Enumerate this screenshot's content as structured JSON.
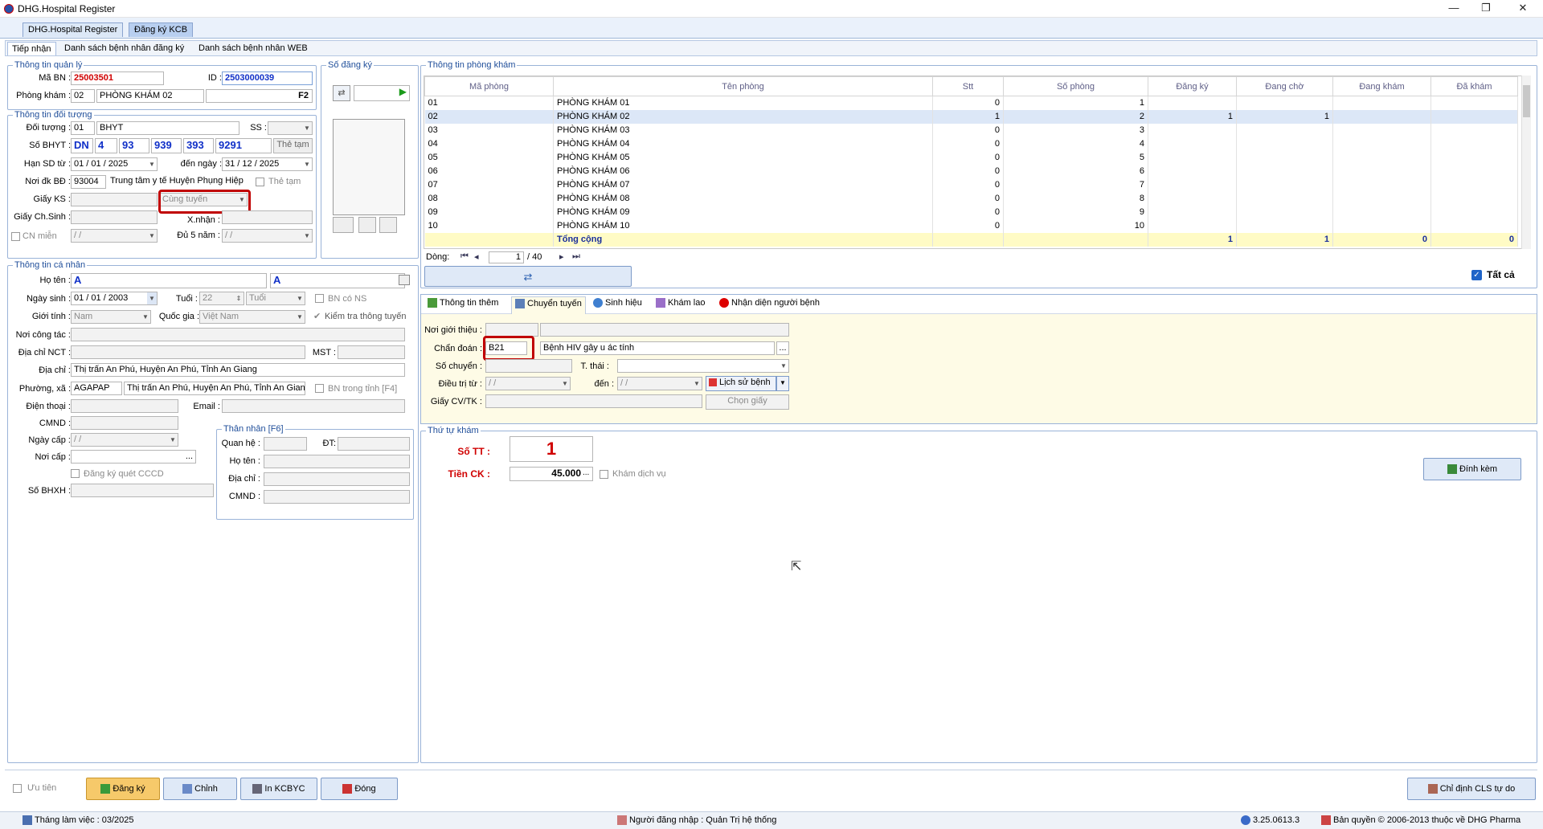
{
  "window": {
    "title": "DHG.Hospital Register",
    "minimize": "—",
    "maximize": "❐",
    "close": "✕"
  },
  "doc_tabs": [
    "DHG.Hospital Register",
    "Đăng ký KCB"
  ],
  "sub_tabs": [
    "Tiếp nhận",
    "Danh sách bệnh nhân đăng ký",
    "Danh sách bệnh nhân WEB"
  ],
  "quanly": {
    "title": "Thông tin quản lý",
    "ma_bn_label": "Mã BN :",
    "ma_bn": "25003501",
    "id_label": "ID :",
    "id": "2503000039",
    "phong_kham_label": "Phòng khám :",
    "phong_code": "02",
    "phong_name": "PHÒNG KHÁM 02",
    "f2": "F2"
  },
  "so_dangky": {
    "title": "Số đăng ký"
  },
  "doituong": {
    "title": "Thông tin đối tượng",
    "doi_tuong_label": "Đối tượng :",
    "doi_tuong_code": "01",
    "doi_tuong_name": "BHYT",
    "ss_label": "SS :",
    "so_bhyt_label": "Số BHYT :",
    "bhyt": [
      "DN",
      "4",
      "93",
      "939",
      "393",
      "9291"
    ],
    "the_tam_btn": "Thẻ tạm",
    "han_label": "Hạn SD từ :",
    "han_tu": "01 / 01 / 2025",
    "den_ngay_label": "đến ngày :",
    "han_den": "31 / 12 / 2025",
    "noi_dk_label": "Nơi đk BĐ :",
    "noi_dk_code": "93004",
    "noi_dk_name": "Trung tâm y tế Huyện Phụng Hiệp",
    "the_tam_chk": "Thẻ tạm",
    "giay_ks_label": "Giấy KS :",
    "tuyen": "Cùng tuyến",
    "giay_chsinh_label": "Giấy Ch.Sinh :",
    "xnhan_label": "X.nhận :",
    "cn_mien_label": "CN miễn",
    "date_blank": "/ /",
    "du5nam_label": "Đủ 5 năm :"
  },
  "canhan": {
    "title": "Thông tin cá nhân",
    "ho_ten_label": "Họ tên :",
    "ho_ten": "A",
    "ho_ten2": "A",
    "ngay_sinh_label": "Ngày sinh :",
    "ngay_sinh": "01 / 01 / 2003",
    "tuoi_label": "Tuổi :",
    "tuoi": "22",
    "tuoi_unit": "Tuổi",
    "bn_co_ns": "BN có NS",
    "gioi_tinh_label": "Giới tính :",
    "gioi_tinh": "Nam",
    "quoc_gia_label": "Quốc gia :",
    "quoc_gia": "Việt Nam",
    "kiem_tra": "Kiểm tra thông tuyến",
    "noi_cong_tac_label": "Nơi công tác :",
    "dia_chi_nct_label": "Địa chỉ NCT :",
    "mst_label": "MST :",
    "dia_chi_label": "Địa chỉ :",
    "dia_chi": "Thị trấn An Phú, Huyện An Phú, Tỉnh An Giang",
    "phuong_xa_label": "Phường, xã :",
    "phuong_code": "AGAPAP",
    "phuong_name": "Thị trấn An Phú, Huyện An Phú, Tỉnh An Giang",
    "bn_trong_tinh": "BN trong tỉnh [F4]",
    "dien_thoai_label": "Điện thoại :",
    "email_label": "Email :",
    "cmnd_label": "CMND :",
    "ngay_cap_label": "Ngày cấp :",
    "noi_cap_label": "Nơi cấp :",
    "dk_cccd": "Đăng ký quét CCCD",
    "so_bhxh_label": "Số BHXH :"
  },
  "thannhan": {
    "title": "Thân nhân [F6]",
    "quan_he_label": "Quan hệ :",
    "dt_label": "ĐT:",
    "ho_ten_label": "Họ tên :",
    "dia_chi_label": "Địa chỉ :",
    "cmnd_label": "CMND :"
  },
  "phongkham": {
    "title": "Thông tin phòng khám",
    "headers": [
      "Mã phòng",
      "Tên phòng",
      "Stt",
      "Số phòng",
      "Đăng ký",
      "Đang chờ",
      "Đang khám",
      "Đã khám"
    ],
    "rows": [
      [
        "01",
        "PHÒNG KHÁM 01",
        "0",
        "1",
        "",
        "",
        "",
        ""
      ],
      [
        "02",
        "PHÒNG KHÁM 02",
        "1",
        "2",
        "1",
        "1",
        "",
        ""
      ],
      [
        "03",
        "PHÒNG KHÁM 03",
        "0",
        "3",
        "",
        "",
        "",
        ""
      ],
      [
        "04",
        "PHÒNG KHÁM 04",
        "0",
        "4",
        "",
        "",
        "",
        ""
      ],
      [
        "05",
        "PHÒNG KHÁM 05",
        "0",
        "5",
        "",
        "",
        "",
        ""
      ],
      [
        "06",
        "PHÒNG KHÁM 06",
        "0",
        "6",
        "",
        "",
        "",
        ""
      ],
      [
        "07",
        "PHÒNG KHÁM 07",
        "0",
        "7",
        "",
        "",
        "",
        ""
      ],
      [
        "08",
        "PHÒNG KHÁM 08",
        "0",
        "8",
        "",
        "",
        "",
        ""
      ],
      [
        "09",
        "PHÒNG KHÁM 09",
        "0",
        "9",
        "",
        "",
        "",
        ""
      ],
      [
        "10",
        "PHÒNG KHÁM 10",
        "0",
        "10",
        "",
        "",
        "",
        ""
      ]
    ],
    "total": [
      "",
      "Tổng cộng",
      "",
      "",
      "1",
      "1",
      "0",
      "0"
    ],
    "dong_label": "Dòng:",
    "page": "1",
    "page_total": "/ 40",
    "tat_ca": "Tất cả"
  },
  "chuyentuyen": {
    "tabs": [
      "Thông tin thêm",
      "Chuyển tuyến",
      "Sinh hiệu",
      "Khám lao",
      "Nhận diện người bệnh"
    ],
    "noi_gioi_thieu_label": "Nơi giới thiệu :",
    "chan_doan_label": "Chẩn đoán :",
    "chan_doan_code": "B21",
    "chan_doan_name": "Bệnh HIV gây u ác tính",
    "so_chuyen_label": "Số chuyển :",
    "t_thai_label": "T. thái :",
    "dieu_tri_label": "Điều trị từ :",
    "den_label": "đến :",
    "lich_su_btn": "Lịch sử bệnh",
    "giay_cv_label": "Giấy CV/TK :",
    "chon_giay_btn": "Chọn giấy"
  },
  "thutu": {
    "title": "Thứ tự khám",
    "so_tt_label": "Số TT :",
    "so_tt": "1",
    "tien_ck_label": "Tiền CK :",
    "tien_ck": "45.000",
    "kham_dich_vu": "Khám dịch vụ",
    "dinh_kem_btn": "Đính kèm"
  },
  "bottom": {
    "uu_tien": "Ưu tiên",
    "dang_ky": "Đăng ký",
    "chinh": "Chỉnh",
    "in_kcbyc": "In KCBYC",
    "dong": "Đóng",
    "chi_dinh": "Chỉ định CLS tự do"
  },
  "status": {
    "thang": "Tháng làm việc : 03/2025",
    "nguoi_dn": "Người đăng nhập : Quản Trị hệ thống",
    "version": "3.25.0613.3",
    "ban_quyen": "Bản quyền © 2006-2013 thuộc về DHG Pharma"
  }
}
